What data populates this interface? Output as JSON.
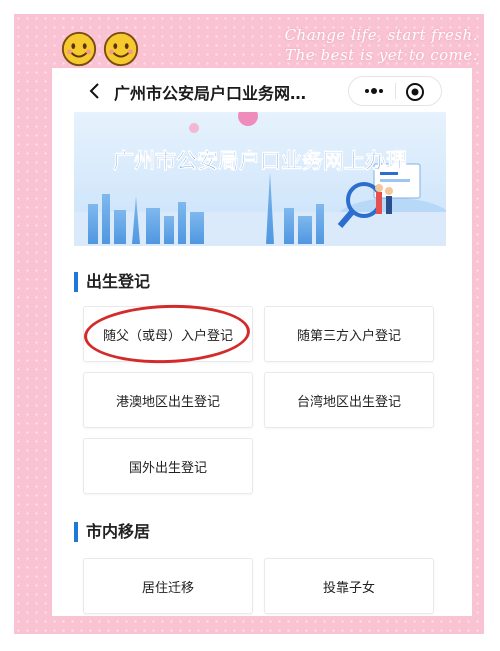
{
  "decor": {
    "line1": "Change life, start fresh.",
    "line2": "The best is yet to come."
  },
  "nav": {
    "title": "广州市公安局户口业务网…"
  },
  "banner": {
    "text": "广州市公安局户口业务网上办理"
  },
  "sections": [
    {
      "title": "出生登记",
      "items": [
        {
          "label": "随父（或母）入户登记"
        },
        {
          "label": "随第三方入户登记"
        },
        {
          "label": "港澳地区出生登记"
        },
        {
          "label": "台湾地区出生登记"
        },
        {
          "label": "国外出生登记"
        }
      ]
    },
    {
      "title": "市内移居",
      "items": [
        {
          "label": "居住迁移"
        },
        {
          "label": "投靠子女"
        }
      ]
    }
  ],
  "colors": {
    "accent": "#1e78d7",
    "frame": "#f9c3d3",
    "highlight": "#d42a2a"
  }
}
